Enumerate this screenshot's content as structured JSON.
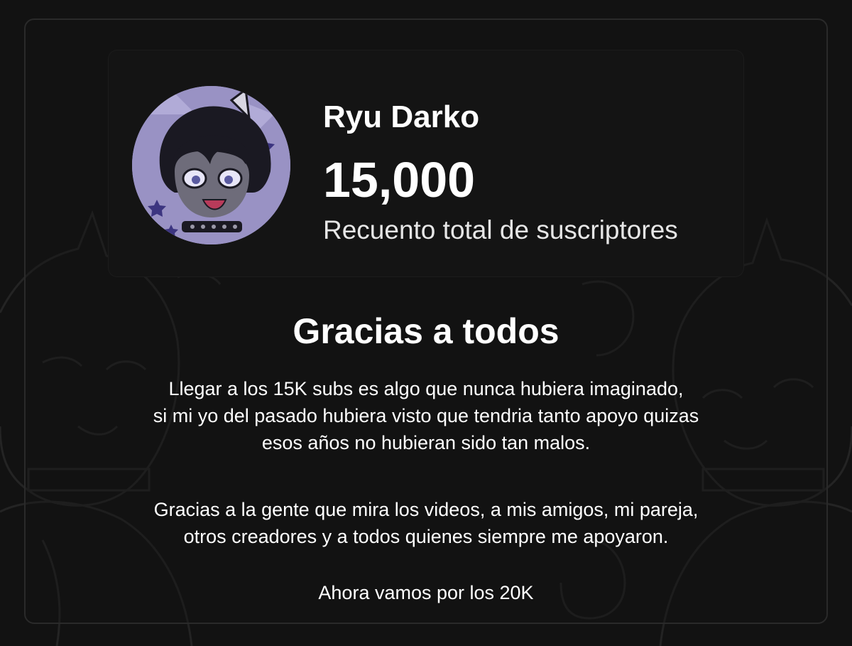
{
  "profile": {
    "name": "Ryu Darko",
    "subscribers": "15,000",
    "subscribers_label": "Recuento total de suscriptores"
  },
  "message": {
    "title": "Gracias a todos",
    "paragraph1": [
      "Llegar a los 15K subs es algo que nunca hubiera imaginado,",
      "si mi yo del pasado hubiera visto que tendria tanto apoyo quizas",
      "esos años no hubieran sido tan malos."
    ],
    "paragraph2": [
      "Gracias a la gente que mira los videos, a mis amigos, mi pareja,",
      "otros creadores y a todos quienes siempre me apoyaron."
    ],
    "closing": "Ahora vamos por los 20K"
  },
  "colors": {
    "background": "#121212",
    "card": "#141414",
    "text": "#ffffff",
    "avatar_bg": "#8f88b8"
  },
  "icons": {
    "avatar": "furry-character-avatar",
    "background": "furry-characters-background-art"
  }
}
